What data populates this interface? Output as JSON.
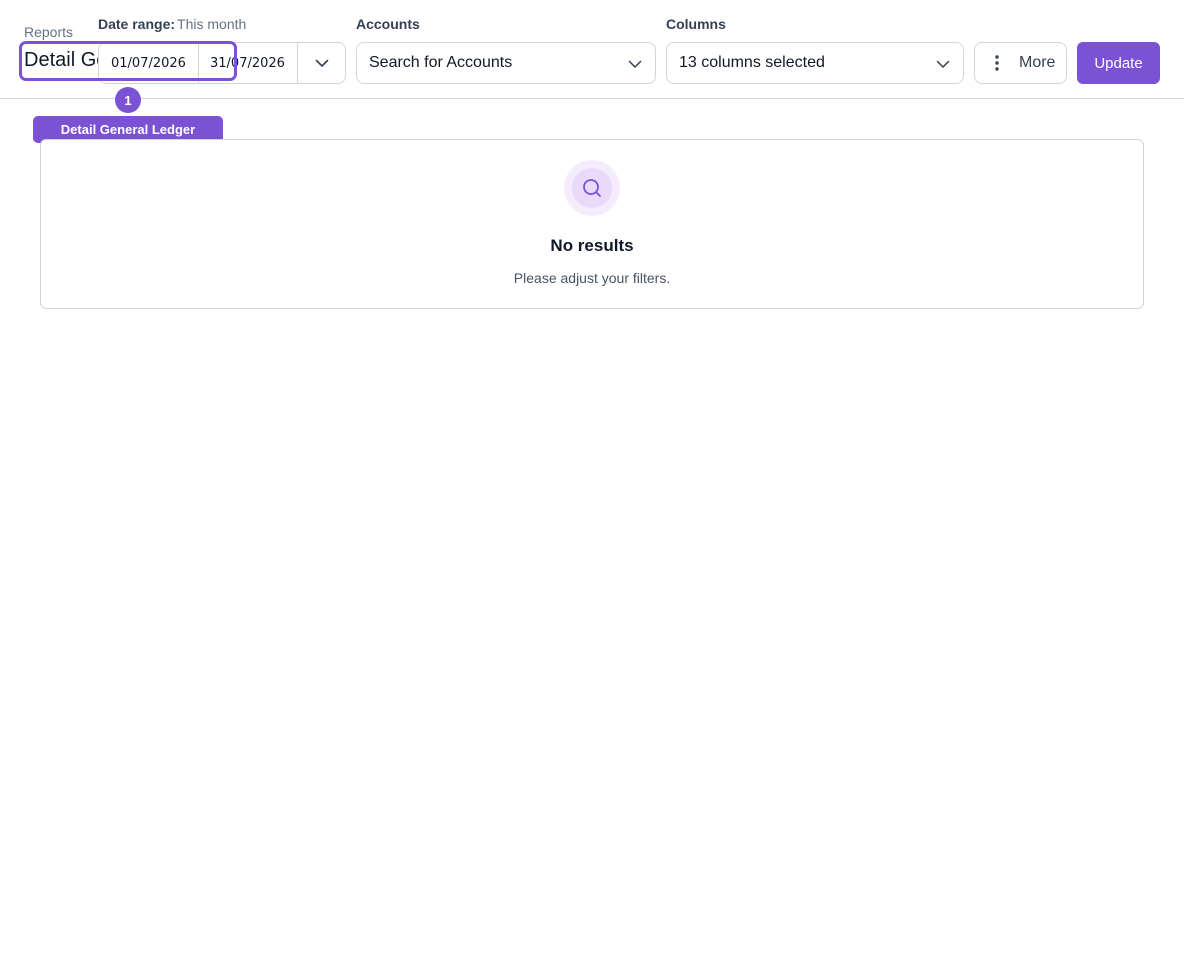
{
  "header": {
    "breadcrumb": "Reports",
    "page_title": "Detail General Ledger"
  },
  "filters": {
    "date_range": {
      "label": "Date range:",
      "preset": "This month",
      "start": "01/07/2026",
      "end": "31/07/2026"
    },
    "accounts": {
      "label": "Accounts",
      "placeholder": "Search for Accounts"
    },
    "columns": {
      "label": "Columns",
      "value": "13 columns selected"
    }
  },
  "actions": {
    "more_label": "More",
    "update_label": "Update"
  },
  "annotation": {
    "marker_number": "1",
    "tooltip": "Detail General Ledger",
    "accent_color": "#7b52d4"
  },
  "empty_state": {
    "icon": "search-icon",
    "title": "No results",
    "subtitle": "Please adjust your filters."
  }
}
